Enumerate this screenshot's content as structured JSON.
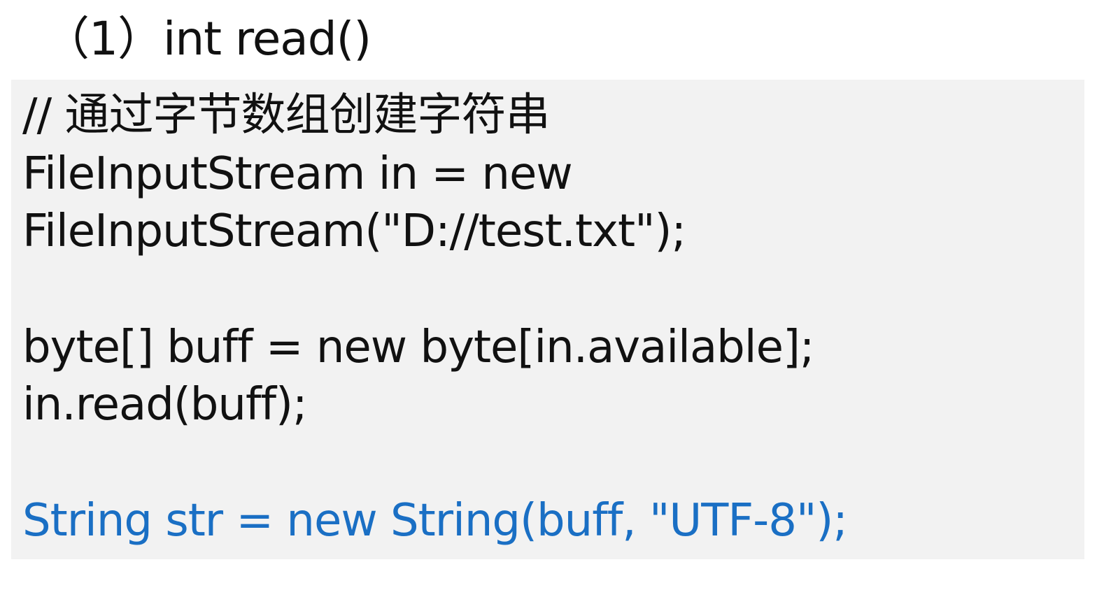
{
  "heading": "（1）int read()",
  "code": {
    "lines": [
      "// 通过字节数组创建字符串",
      "FileInputStream in = new",
      "FileInputStream(\"D://test.txt\");",
      "byte[] buff = new byte[in.available];",
      "in.read(buff);",
      "String str = new String(buff, \"UTF-8\");"
    ]
  },
  "colors": {
    "code_background": "#f2f2f2",
    "highlight_text": "#1a6fc4",
    "default_text": "#111111"
  }
}
